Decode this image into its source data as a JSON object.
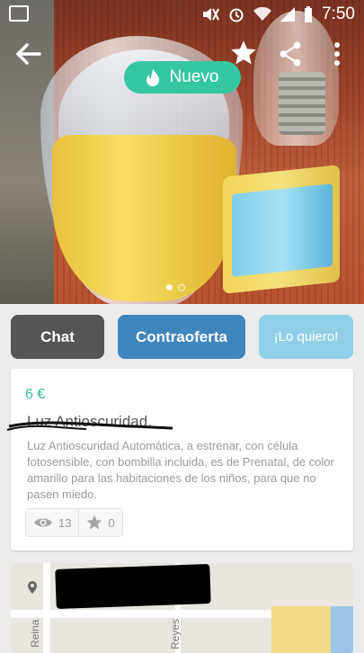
{
  "status_bar": {
    "time": "7:50"
  },
  "badge": {
    "label": "Nuevo"
  },
  "actions": {
    "chat": "Chat",
    "counteroffer": "Contraoferta",
    "want": "¡Lo quiero!"
  },
  "item": {
    "price": "6 €",
    "title": "Luz Antioscuridad.",
    "description": "Luz Antioscuridad Automática, a estrenar, con célula fotosensible, con bombilla incluida, es de Prenatal, de color amarillo para las habitaciones de los niños, para que no pasen miedo.",
    "views": "13",
    "favorites": "0"
  },
  "map": {
    "street_a": "Reina",
    "street_b": "Reyes"
  },
  "colors": {
    "accent_green": "#36c6a1",
    "counteroffer_blue": "#3f86bf",
    "want_lightblue": "#8fd0e6",
    "chat_gray": "#555555"
  }
}
